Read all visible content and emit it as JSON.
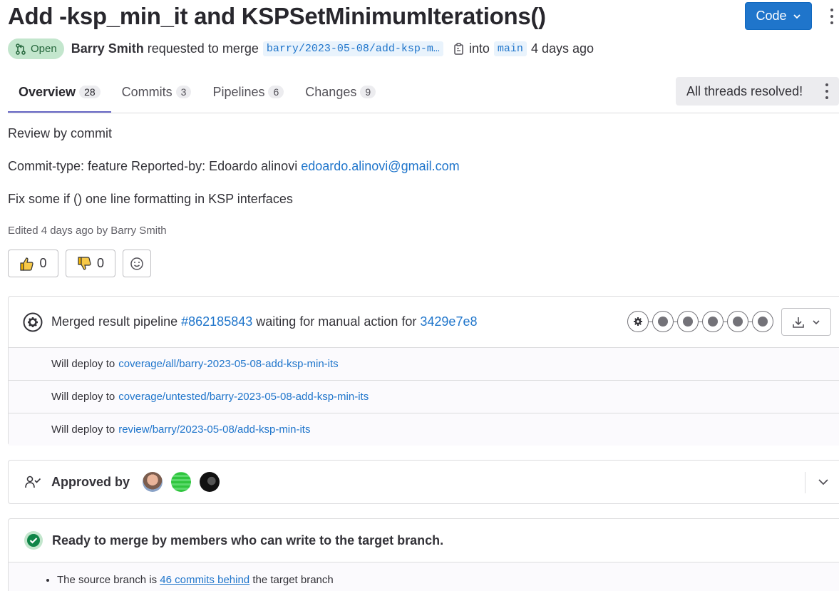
{
  "header": {
    "title": "Add -ksp_min_it and KSPSetMinimumIterations()",
    "code_button": "Code",
    "status": "Open",
    "author": "Barry Smith",
    "requested_text": "requested to merge",
    "source_branch": "barry/2023-05-08/add-ksp-m…",
    "into_text": "into",
    "target_branch": "main",
    "time_ago": "4 days ago"
  },
  "tabs": [
    {
      "label": "Overview",
      "count": "28"
    },
    {
      "label": "Commits",
      "count": "3"
    },
    {
      "label": "Pipelines",
      "count": "6"
    },
    {
      "label": "Changes",
      "count": "9"
    }
  ],
  "threads_status": "All threads resolved!",
  "description": {
    "line1": "Review by commit",
    "line2_prefix": "Commit-type: feature Reported-by: Edoardo alinovi",
    "line2_email": "edoardo.alinovi@gmail.com",
    "line3": "Fix some if () one line formatting in KSP interfaces",
    "edited": "Edited 4 days ago by Barry Smith"
  },
  "reactions": {
    "thumbs_up": "0",
    "thumbs_down": "0"
  },
  "pipeline": {
    "prefix": "Merged result pipeline",
    "pipeline_id": "#862185843",
    "middle": "waiting for manual action for",
    "commit_sha": "3429e7e8",
    "deploy_label": "Will deploy to",
    "deployments": [
      "coverage/all/barry-2023-05-08-add-ksp-min-its",
      "coverage/untested/barry-2023-05-08-add-ksp-min-its",
      "review/barry/2023-05-08/add-ksp-min-its"
    ]
  },
  "approvals": {
    "label": "Approved by"
  },
  "merge": {
    "title": "Ready to merge by members who can write to the target branch.",
    "detail_prefix": "The source branch is",
    "detail_link": "46 commits behind",
    "detail_suffix": "the target branch"
  },
  "colors": {
    "primary": "#1f75cb",
    "open_badge_bg": "#c3e6cd",
    "open_badge_text": "#24663b",
    "success": "#108548",
    "active_tab_underline": "#6666c4"
  }
}
